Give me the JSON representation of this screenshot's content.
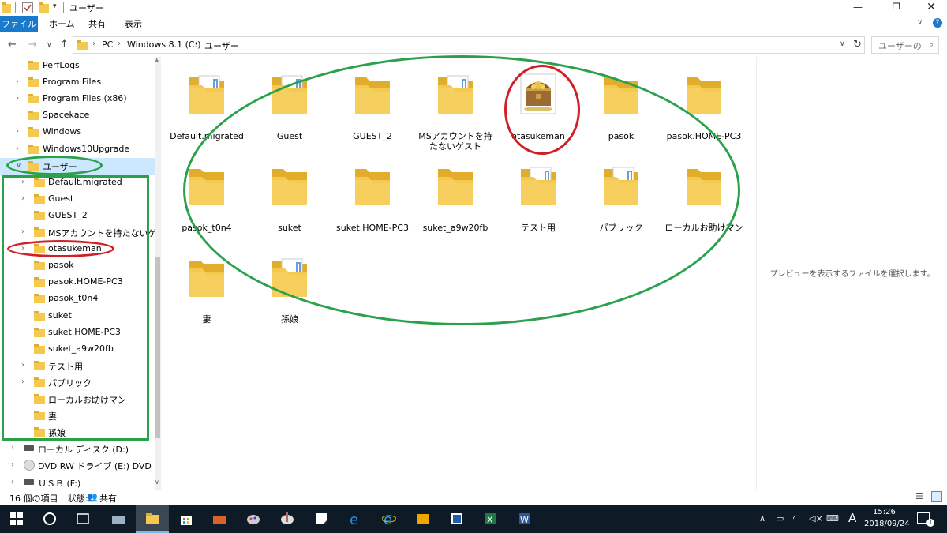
{
  "window": {
    "title": "ユーザー",
    "min_glyph": "—",
    "max_glyph": "❐",
    "close_glyph": "✕"
  },
  "ribbon": {
    "tabs": [
      "ファイル",
      "ホーム",
      "共有",
      "表示"
    ],
    "expand_glyph": "∨",
    "help_glyph": "?"
  },
  "address": {
    "back_glyph": "←",
    "forward_glyph": "→",
    "recent_glyph": "∨",
    "up_glyph": "↑",
    "crumbs": [
      "PC",
      "Windows 8.1 (C:)",
      "ユーザー"
    ],
    "crumb_sep": "›",
    "dropdown_glyph": "∨",
    "refresh_glyph": "↻",
    "search_placeholder": "ユーザーの",
    "search_glyph": "⌕"
  },
  "tree": {
    "expand_glyph": "›",
    "expanded_glyph": "∨",
    "items": [
      {
        "label": "PerfLogs",
        "arrow": false
      },
      {
        "label": "Program Files",
        "arrow": true
      },
      {
        "label": "Program Files (x86)",
        "arrow": true
      },
      {
        "label": "Spacekace",
        "arrow": false
      },
      {
        "label": "Windows",
        "arrow": true
      },
      {
        "label": "Windows10Upgrade",
        "arrow": true
      },
      {
        "label": "ユーザー",
        "arrow": true,
        "expanded": true,
        "selected": true
      }
    ],
    "children": [
      {
        "label": "Default.migrated",
        "arrow": true
      },
      {
        "label": "Guest",
        "arrow": true
      },
      {
        "label": "GUEST_2",
        "arrow": false
      },
      {
        "label": "MSアカウントを持たないゲスト",
        "arrow": true
      },
      {
        "label": "otasukeman",
        "arrow": true
      },
      {
        "label": "pasok",
        "arrow": false
      },
      {
        "label": "pasok.HOME-PC3",
        "arrow": false
      },
      {
        "label": "pasok_t0n4",
        "arrow": false
      },
      {
        "label": "suket",
        "arrow": false
      },
      {
        "label": "suket.HOME-PC3",
        "arrow": false
      },
      {
        "label": "suket_a9w20fb",
        "arrow": false
      },
      {
        "label": "テスト用",
        "arrow": true
      },
      {
        "label": "パブリック",
        "arrow": true
      },
      {
        "label": "ローカルお助けマン",
        "arrow": false
      },
      {
        "label": "妻",
        "arrow": false
      },
      {
        "label": "孫娘",
        "arrow": false
      }
    ],
    "drives": [
      {
        "label": "ローカル ディスク (D:)",
        "icon": "drive-icon"
      },
      {
        "label": "DVD RW ドライブ (E:) DVD",
        "icon": "dvd-icon"
      },
      {
        "label": "ＵＳＢ (F:)",
        "icon": "usb-drive-icon"
      }
    ]
  },
  "folders": [
    {
      "label": "Default.migrated",
      "icon": "folder-docs"
    },
    {
      "label": "Guest",
      "icon": "folder-docs"
    },
    {
      "label": "GUEST_2",
      "icon": "folder"
    },
    {
      "label": "MSアカウントを持たないゲスト",
      "icon": "folder-docs"
    },
    {
      "label": "otasukeman",
      "icon": "treasure-chest"
    },
    {
      "label": "pasok",
      "icon": "folder"
    },
    {
      "label": "pasok.HOME-PC3",
      "icon": "folder"
    },
    {
      "label": "pasok_t0n4",
      "icon": "folder"
    },
    {
      "label": "suket",
      "icon": "folder"
    },
    {
      "label": "suket.HOME-PC3",
      "icon": "folder"
    },
    {
      "label": "suket_a9w20fb",
      "icon": "folder"
    },
    {
      "label": "テスト用",
      "icon": "folder-docs"
    },
    {
      "label": "パブリック",
      "icon": "folder-docs"
    },
    {
      "label": "ローカルお助けマン",
      "icon": "folder"
    },
    {
      "label": "妻",
      "icon": "folder"
    },
    {
      "label": "孫娘",
      "icon": "folder-docs"
    }
  ],
  "preview_message": "プレビューを表示するファイルを選択します。",
  "status": {
    "count": "16 個の項目",
    "state_label": "状態:",
    "share": "共有"
  },
  "taskbar": {
    "apps": [
      "start",
      "cortana",
      "task-view",
      "scanner",
      "file-explorer",
      "store",
      "toolbox",
      "paint",
      "paint-brush",
      "sticky-notes",
      "edge",
      "internet-explorer",
      "app-yellow",
      "app-blue",
      "excel",
      "word"
    ],
    "ime": "A",
    "time": "15:26",
    "date": "2018/09/24",
    "notifications": "1"
  },
  "colors": {
    "accent": "#1979ca",
    "folder": "#f4c94f",
    "folder_dark": "#e2ad2b",
    "annotation_green": "#2aa14a",
    "annotation_red": "#d02027",
    "taskbar": "#0e1b26"
  }
}
